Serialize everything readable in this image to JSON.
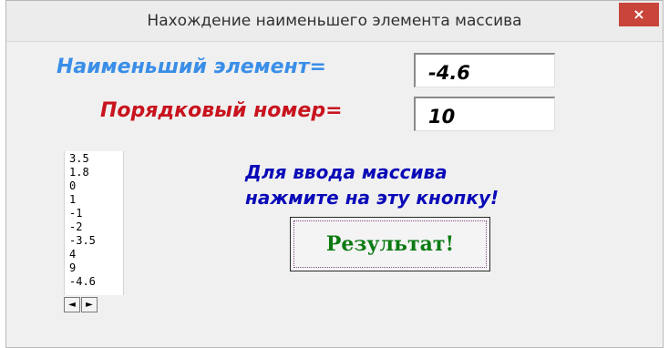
{
  "window": {
    "title": "Нахождение наименьшего элемента массива",
    "close_label": "×"
  },
  "labels": {
    "min_element": "Наименьший элемент=",
    "index": "Порядковый номер="
  },
  "fields": {
    "min_value": "-4.6",
    "index_value": "10"
  },
  "listbox": {
    "items": [
      "3.5",
      "1.8",
      "0",
      "1",
      "-1",
      "-2",
      "-3.5",
      "4",
      "9",
      "-4.6"
    ],
    "scroll_left": "◄",
    "scroll_right": "►"
  },
  "instruction": {
    "line1": "Для ввода массива",
    "line2": "нажмите на эту кнопку!"
  },
  "button": {
    "result_label": "Результат!"
  },
  "colors": {
    "label_min": "#3a8ee8",
    "label_idx": "#c8141e",
    "instruction": "#0a0ab8",
    "button_text": "#0c7a12",
    "close_bg": "#c9453a"
  }
}
